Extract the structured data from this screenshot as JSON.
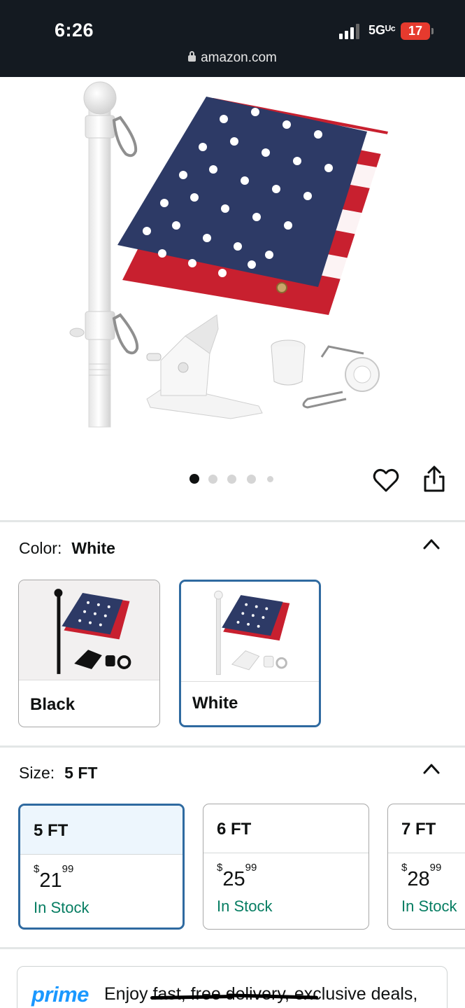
{
  "status_bar": {
    "time": "6:26",
    "network": "5Gᵁᶜ",
    "battery": "17",
    "url": "amazon.com"
  },
  "gallery": {
    "image_count": 5,
    "active_index": 0
  },
  "color_section": {
    "label": "Color:",
    "selected_value": "White",
    "options": [
      {
        "label": "Black",
        "selected": false
      },
      {
        "label": "White",
        "selected": true
      }
    ]
  },
  "size_section": {
    "label": "Size:",
    "selected_value": "5 FT",
    "options": [
      {
        "label": "5 FT",
        "currency": "$",
        "price_whole": "21",
        "price_fraction": "99",
        "stock": "In Stock",
        "selected": true
      },
      {
        "label": "6 FT",
        "currency": "$",
        "price_whole": "25",
        "price_fraction": "99",
        "stock": "In Stock",
        "selected": false
      },
      {
        "label": "7 FT",
        "currency": "$",
        "price_whole": "28",
        "price_fraction": "99",
        "stock": "In Stock",
        "selected": false
      }
    ]
  },
  "prime": {
    "logo": "prime",
    "text": "Enjoy fast, free delivery, exclusive deals,"
  },
  "colors": {
    "status_bar_bg": "#141a21",
    "battery_red": "#e63a2e",
    "selected_border": "#2f6aa0",
    "in_stock_green": "#067d62",
    "prime_blue": "#1a98ff",
    "flag_blue": "#2d3a66",
    "flag_red": "#c8202f"
  },
  "icons": [
    "lock-icon",
    "heart-icon",
    "share-icon",
    "chevron-up-icon"
  ]
}
